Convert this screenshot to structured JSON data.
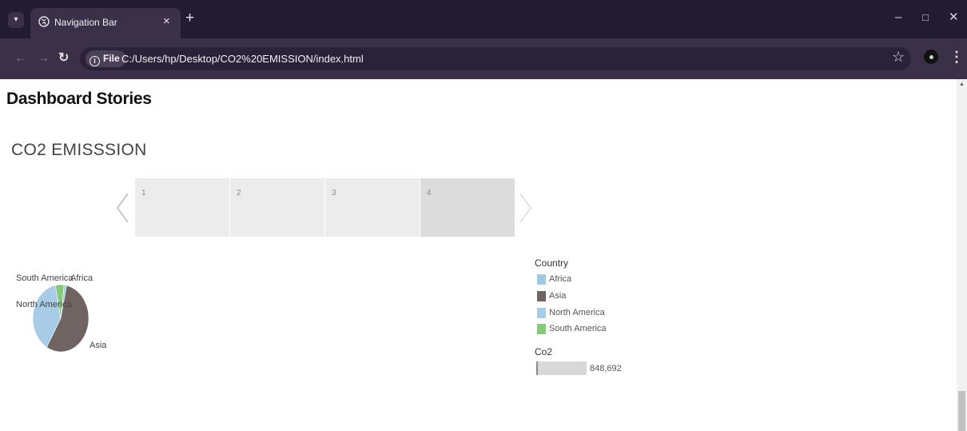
{
  "browser": {
    "tab_title": "Navigation Bar",
    "file_chip": "File",
    "url": "C:/Users/hp/Desktop/CO2%20EMISSION/index.html"
  },
  "page": {
    "heading": "Dashboard Stories",
    "section_title": "CO2 EMISSSION"
  },
  "story_points": [
    {
      "label": "1",
      "active": false
    },
    {
      "label": "2",
      "active": false
    },
    {
      "label": "3",
      "active": false
    },
    {
      "label": "4",
      "active": true
    }
  ],
  "chart_data": {
    "type": "pie",
    "categories": [
      "Africa",
      "Asia",
      "North America",
      "South America"
    ],
    "values": [
      1.5,
      55,
      38.5,
      5
    ],
    "colors": [
      "#a0c8e0",
      "#6f6461",
      "#a8cce6",
      "#86c97b"
    ]
  },
  "legend": {
    "title": "Country",
    "items": [
      {
        "label": "Africa",
        "color": "#a0c8e0"
      },
      {
        "label": "Asia",
        "color": "#6f6461"
      },
      {
        "label": "North America",
        "color": "#a8cce6"
      },
      {
        "label": "South America",
        "color": "#86c97b"
      }
    ]
  },
  "size_legend": {
    "title": "Co2",
    "value": "848,692"
  },
  "icons": {
    "tab_menu": "chevron-down-icon",
    "favicon": "globe-icon",
    "prev": "chevron-left-icon",
    "next": "chevron-right-icon"
  }
}
